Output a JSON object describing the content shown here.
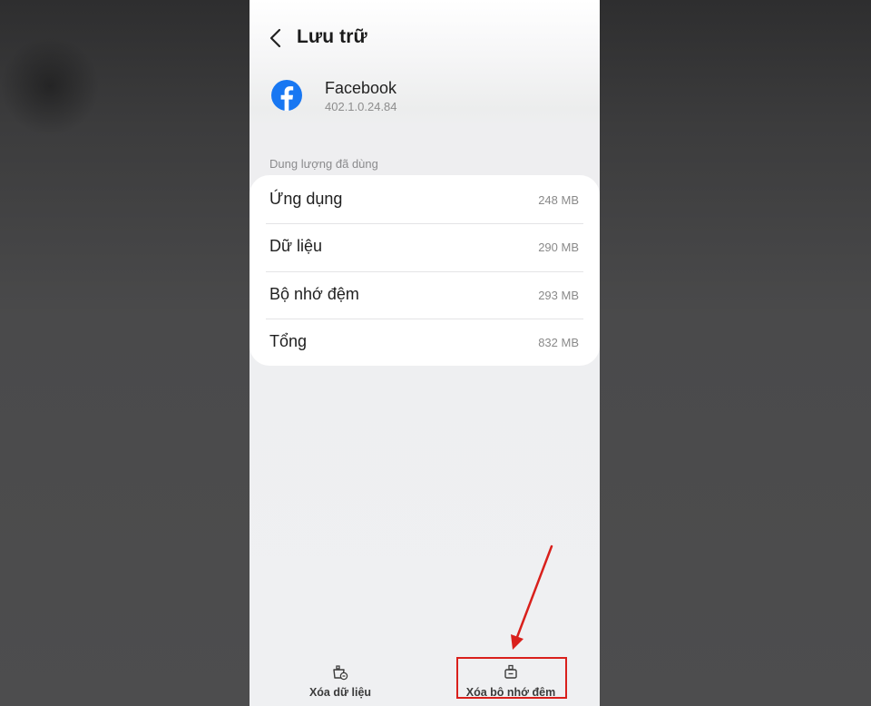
{
  "header": {
    "title": "Lưu trữ"
  },
  "app": {
    "name": "Facebook",
    "version": "402.1.0.24.84"
  },
  "storage": {
    "section_label": "Dung lượng đã dùng",
    "rows": [
      {
        "label": "Ứng dụng",
        "value": "248 MB"
      },
      {
        "label": "Dữ liệu",
        "value": "290 MB"
      },
      {
        "label": "Bộ nhớ đệm",
        "value": "293 MB"
      },
      {
        "label": "Tổng",
        "value": "832 MB"
      }
    ]
  },
  "actions": {
    "clear_data": {
      "label": "Xóa dữ liệu",
      "icon": "clear-data-icon"
    },
    "clear_cache": {
      "label": "Xóa bộ nhớ đệm",
      "icon": "clear-cache-icon"
    }
  },
  "colors": {
    "facebook_blue": "#1877f2",
    "annotation_red": "#d9201c"
  }
}
